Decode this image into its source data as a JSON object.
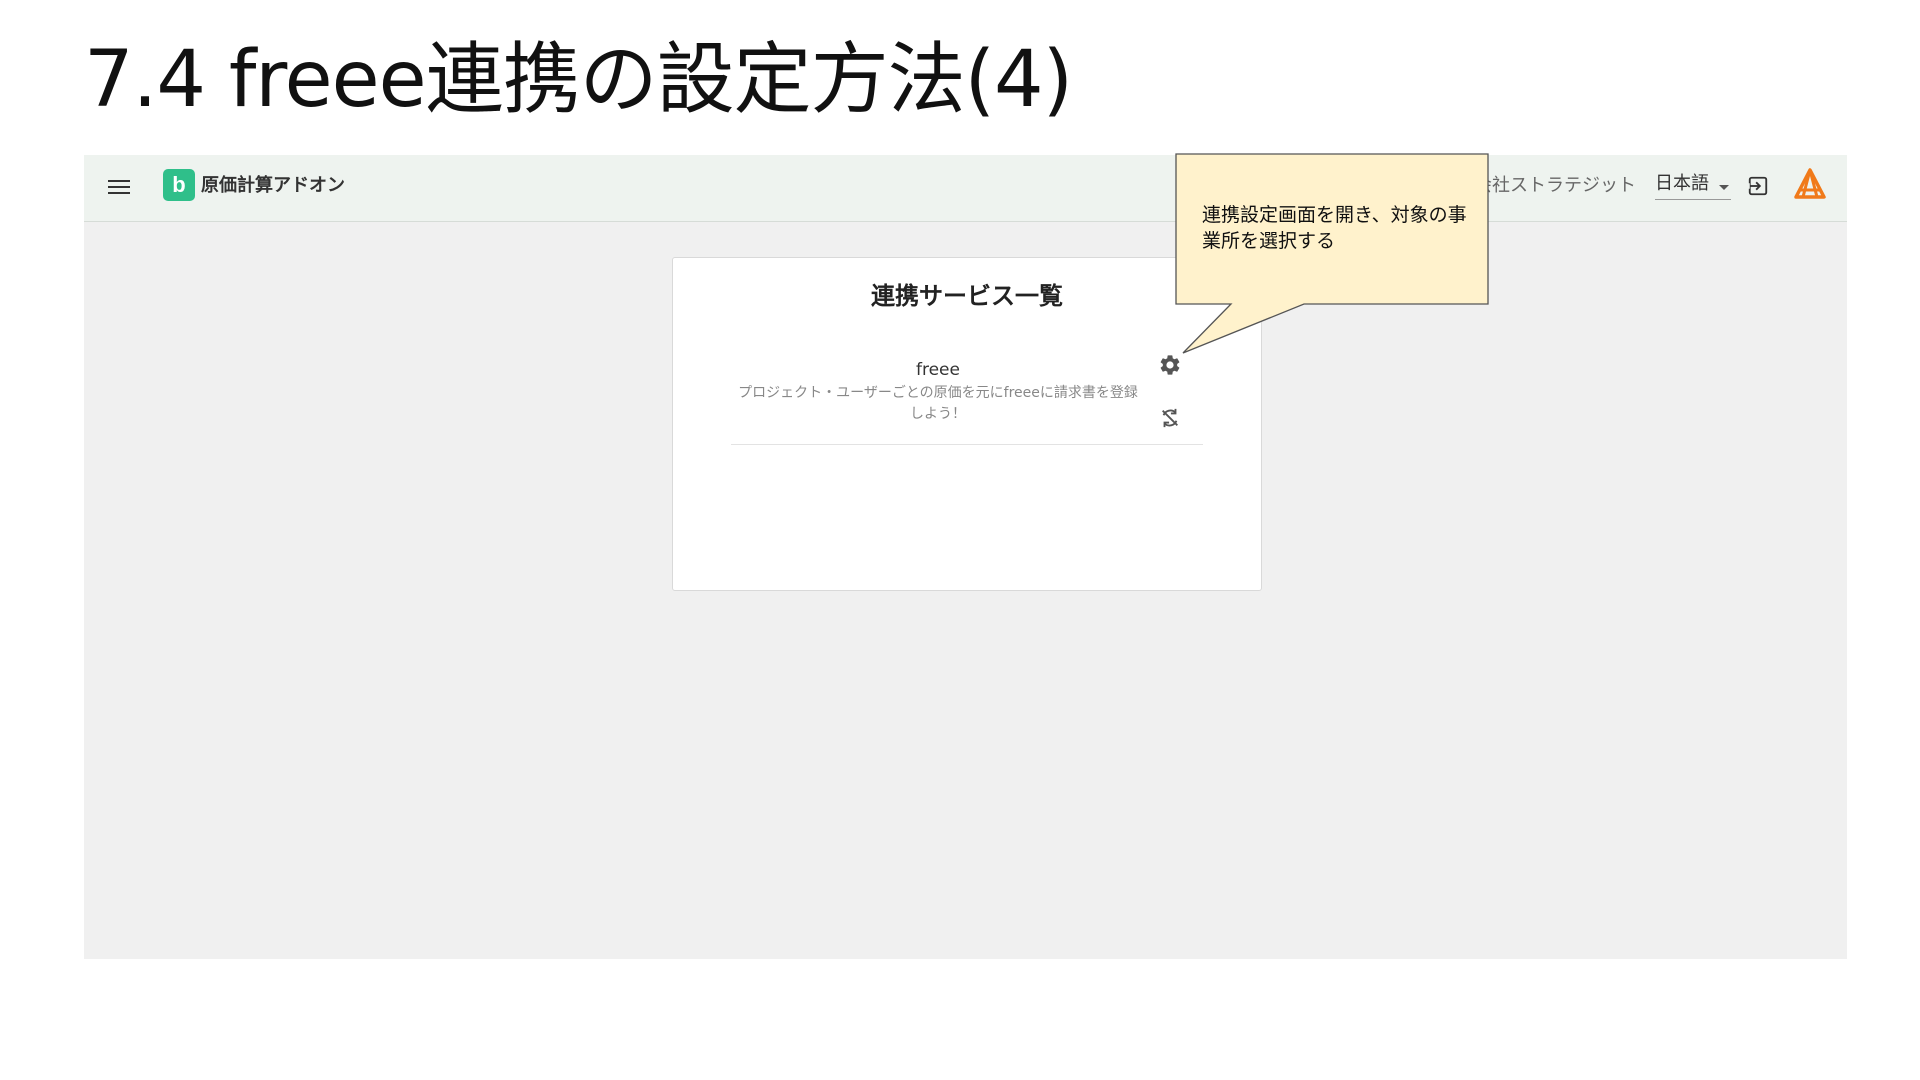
{
  "slide": {
    "title": "7.4 freee連携の設定方法(4)"
  },
  "header": {
    "app_logo_letter": "b",
    "app_name": "原価計算アドオン",
    "company": "会社ストラテジット",
    "language": "日本語",
    "menu_icon": "hamburger-menu-icon",
    "logout_icon": "logout-icon",
    "brand_icon": "brand-logo-icon",
    "accent_color": "#2fbf8a",
    "brand_color": "#f07a1a"
  },
  "card": {
    "title": "連携サービス一覧",
    "services": [
      {
        "name": "freee",
        "description": "プロジェクト・ユーザーごとの原価を元にfreeeに請求書を登録しよう！",
        "settings_icon": "gear-icon",
        "sync_icon": "sync-disabled-icon"
      }
    ]
  },
  "callout": {
    "text": "連携設定画面を開き、対象の事業所を選択する",
    "fill_color": "#fff2cc"
  }
}
